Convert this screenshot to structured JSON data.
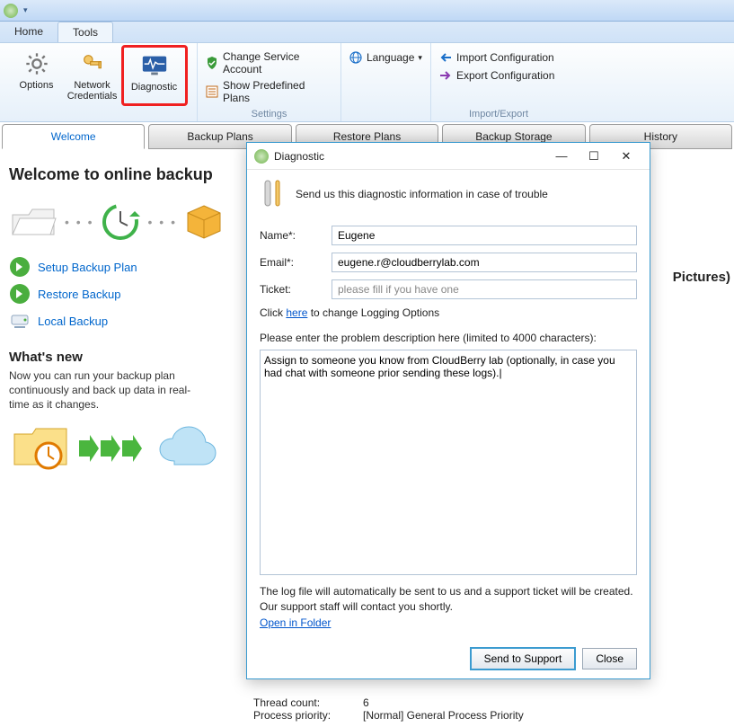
{
  "menutabs": {
    "home": "Home",
    "tools": "Tools"
  },
  "ribbon": {
    "options": "Options",
    "network": "Network\nCredentials",
    "diagnostic": "Diagnostic",
    "change_service": "Change Service Account",
    "show_plans": "Show Predefined Plans",
    "language": "Language",
    "import": "Import Configuration",
    "export": "Export Configuration",
    "g_settings": "Settings",
    "g_impexp": "Import/Export"
  },
  "maintabs": {
    "welcome": "Welcome",
    "backup": "Backup Plans",
    "restore": "Restore Plans",
    "storage": "Backup Storage",
    "history": "History"
  },
  "content": {
    "title": "Welcome to online backup",
    "setup": "Setup Backup Plan",
    "restore": "Restore Backup",
    "local": "Local Backup",
    "whatsnew_h": "What's new",
    "whatsnew_p": "Now you can run your backup plan continuously and back up data in real-time as it changes."
  },
  "peek": "Pictures)",
  "status": {
    "threads_k": "Thread count:",
    "threads_v": "6",
    "prio_k": "Process priority:",
    "prio_v": "[Normal] General Process Priority"
  },
  "dialog": {
    "title": "Diagnostic",
    "header": "Send us this diagnostic information in case of trouble",
    "name_l": "Name*:",
    "name_v": "Eugene",
    "email_l": "Email*:",
    "email_v": "eugene.r@cloudberrylab.com",
    "ticket_l": "Ticket:",
    "ticket_ph": "please fill if you have one",
    "log_pre": "Click ",
    "log_link": "here",
    "log_post": " to change Logging Options",
    "desc_l": "Please enter the problem description here (limited to 4000 characters):",
    "desc_v": "Assign to someone you know from CloudBerry lab (optionally, in case you had chat with someone prior sending these logs).|",
    "tail": "The log file will automatically be sent to us and a support ticket will be created. Our support staff will contact you shortly.",
    "open": "Open in Folder",
    "send": "Send to Support",
    "close": "Close"
  }
}
